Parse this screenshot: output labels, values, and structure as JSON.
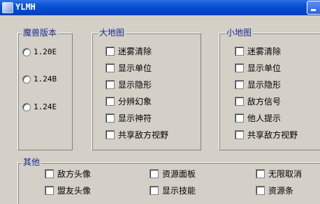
{
  "window": {
    "title": "YLMH"
  },
  "groups": {
    "version": {
      "title": "魔兽版本",
      "options": [
        "1.20E",
        "1.24B",
        "1.24E"
      ]
    },
    "bigmap": {
      "title": "大地图",
      "options": [
        "迷雾清除",
        "显示单位",
        "显示隐形",
        "分辨幻象",
        "显示神符",
        "共享敌方视野"
      ]
    },
    "minimap": {
      "title": "小地图",
      "options": [
        "迷雾清除",
        "显示单位",
        "显示隐形",
        "敌方信号",
        "他人提示",
        "共享敌方视野"
      ]
    },
    "other": {
      "title": "其他",
      "options": [
        "敌方头像",
        "资源面板",
        "无限取消",
        "盟友头像",
        "显示技能",
        "资源条"
      ]
    }
  }
}
